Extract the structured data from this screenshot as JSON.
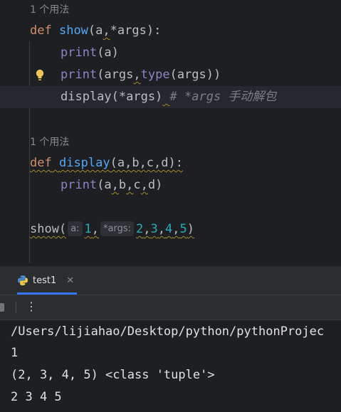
{
  "editor": {
    "usage1": "1 个用法",
    "usage2": "1 个用法",
    "l1": {
      "kw": "def",
      "fn": "show",
      "p1": "(",
      "a": "a",
      "c1": ",",
      "rest": "*args):"
    },
    "l2": {
      "bi": "print",
      "rest": "(a)"
    },
    "l3": {
      "bi": "print",
      "p1": "(args",
      "c1": ",",
      "bi2": "type",
      "rest": "(args))"
    },
    "l4": {
      "code": "display(*args)",
      "comment": "# *args 手动解包"
    },
    "l5": {
      "kw": "def",
      "fn": "display",
      "params": "(a,b,c,d):"
    },
    "l6": {
      "bi": "print",
      "p": "(a",
      "c1": ",",
      "b": "b",
      "c2": ",",
      "c": "c",
      "c3": ",",
      "end": "d)"
    },
    "l7": {
      "call": "show(",
      "hint1": "a:",
      "v1": "1",
      "c0": ",",
      "hint2": "*args:",
      "v2": "2",
      "s1": ",",
      "v3": "3",
      "s2": ",",
      "v4": "4",
      "s3": ",",
      "v5": "5",
      "end": ")"
    }
  },
  "run": {
    "tab_label": "test1",
    "output": [
      "/Users/lijiahao/Desktop/python/pythonProjec",
      "1",
      "(2, 3, 4, 5) <class 'tuple'>",
      "2 3 4 5"
    ]
  },
  "icons": {
    "tab": "python-file-icon",
    "bulb": "lightbulb-icon",
    "close": "close-icon",
    "stop": "stop-icon",
    "more": "more-vertical-icon"
  },
  "colors": {
    "keyword": "#cf8e6d",
    "function": "#56a8f5",
    "builtin": "#8888c6",
    "number": "#2aacb8",
    "comment": "#7a7e85",
    "accent": "#3574f0"
  }
}
